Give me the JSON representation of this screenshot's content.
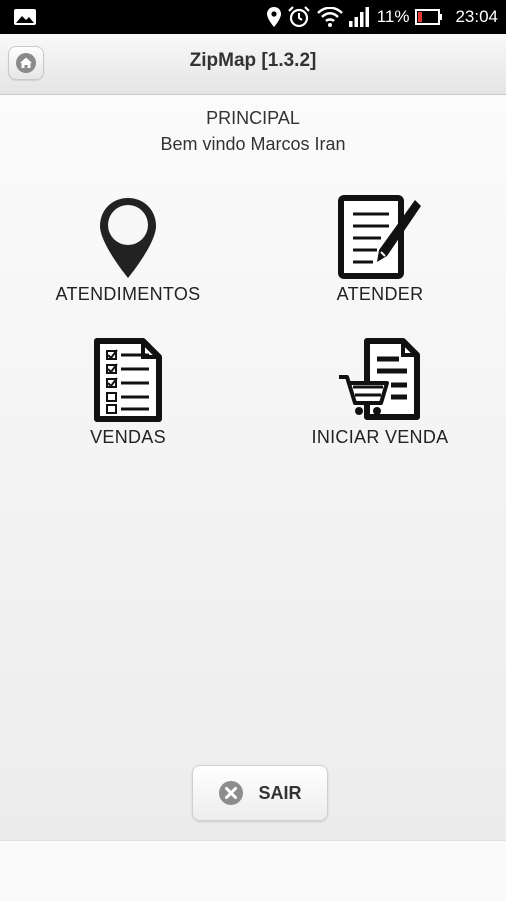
{
  "status_bar": {
    "battery": "11%",
    "time": "23:04",
    "icons": [
      "image-notification-icon",
      "location-icon",
      "alarm-icon",
      "wifi-icon",
      "signal-icon",
      "battery-icon"
    ]
  },
  "app_bar": {
    "title": "ZipMap [1.3.2]",
    "home_icon": "home-icon"
  },
  "main": {
    "section_title": "PRINCIPAL",
    "welcome": "Bem vindo Marcos Iran",
    "tiles": [
      {
        "label": "ATENDIMENTOS",
        "icon": "map-pin-icon"
      },
      {
        "label": "ATENDER",
        "icon": "form-pen-icon"
      },
      {
        "label": "VENDAS",
        "icon": "checklist-icon"
      },
      {
        "label": "INICIAR VENDA",
        "icon": "cart-document-icon"
      }
    ]
  },
  "exit_button": {
    "label": "SAIR",
    "icon": "close-circle-icon"
  },
  "colors": {
    "status_bar": "#000000",
    "icon": "#222222"
  }
}
